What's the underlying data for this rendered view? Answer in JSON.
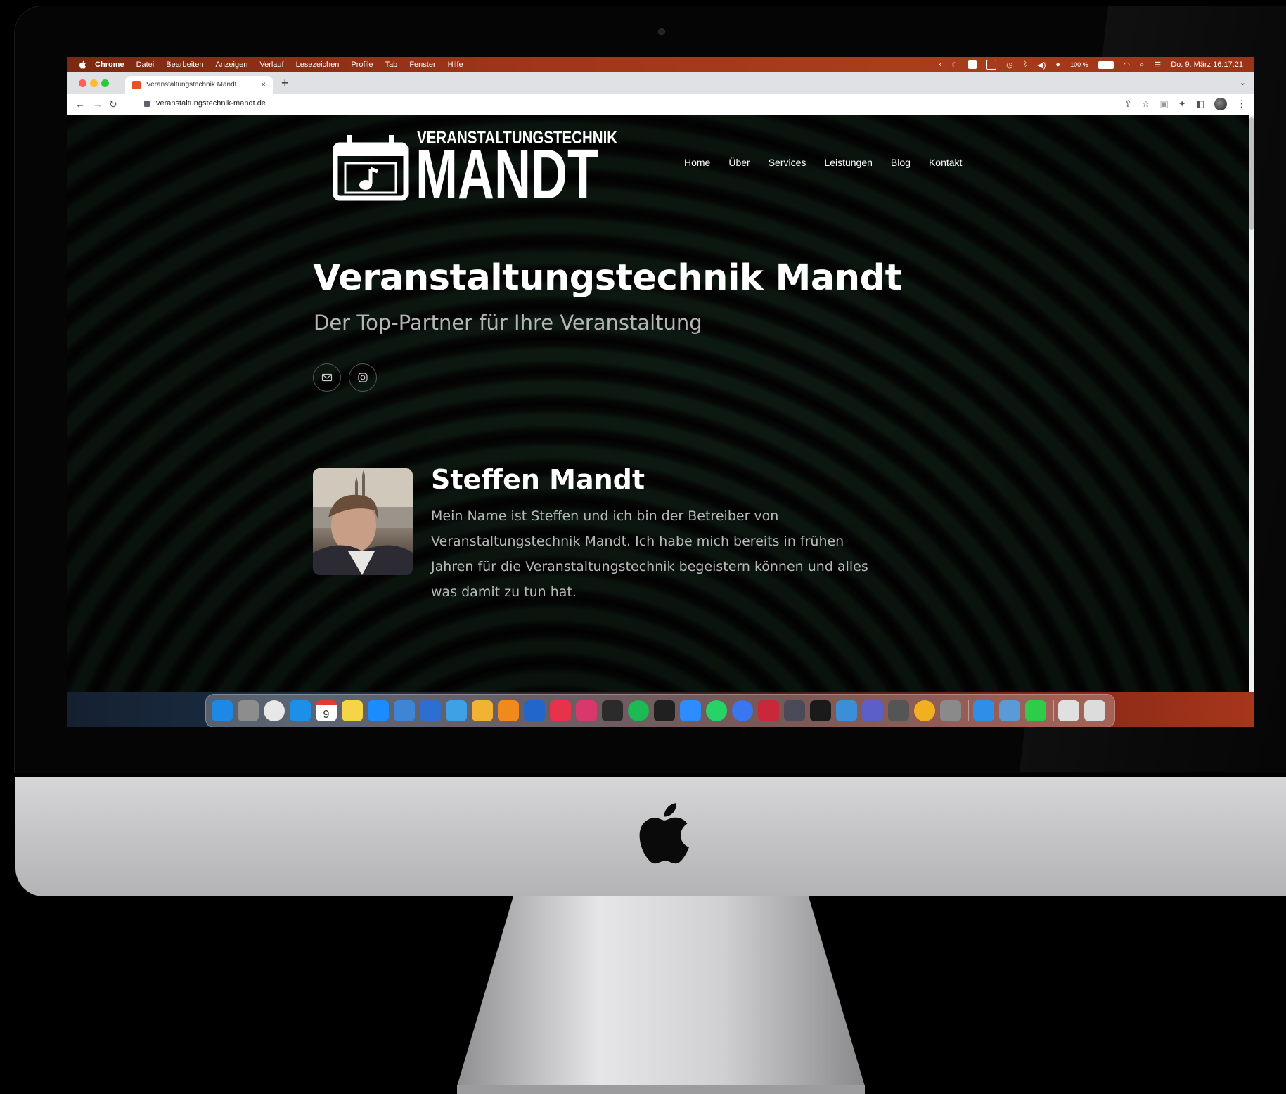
{
  "menubar": {
    "items": [
      "Chrome",
      "Datei",
      "Bearbeiten",
      "Anzeigen",
      "Verlauf",
      "Lesezeichen",
      "Profile",
      "Tab",
      "Fenster",
      "Hilfe"
    ],
    "battery": "100 %",
    "datetime": "Do. 9. März  16:17:21"
  },
  "browser": {
    "tab_title": "Veranstaltungstechnik Mandt",
    "url": "veranstaltungstechnik-mandt.de",
    "new_tab_symbol": "+"
  },
  "site": {
    "logo_small": "VERANSTALTUNGSTECHNIK",
    "logo_big": "MANDT",
    "nav": [
      "Home",
      "Über",
      "Services",
      "Leistungen",
      "Blog",
      "Kontakt"
    ],
    "hero_title": "Veranstaltungstechnik Mandt",
    "hero_subtitle": "Der Top-Partner für Ihre Veranstaltung",
    "social_icons": [
      "mail-icon",
      "instagram-icon"
    ],
    "bio": {
      "name": "Steffen Mandt",
      "text": "Mein Name ist Steffen und ich bin der Betreiber von Veranstaltungstechnik Mandt. Ich habe mich bereits in frühen Jahren für die Veranstaltungstechnik begeistern können und alles was damit zu tun hat."
    }
  },
  "dock": {
    "icons": [
      "finder-icon",
      "launchpad-icon",
      "chrome-icon",
      "mail-icon",
      "calendar-icon",
      "notes-icon",
      "app-store-icon",
      "xcode-icon",
      "simulator-icon",
      "ssh-icon",
      "cyberduck-icon",
      "sublime-icon",
      "1password-icon",
      "creative-cloud-icon",
      "intellij-icon",
      "final-cut-icon",
      "spotify-icon",
      "terminal-icon",
      "zoom-icon",
      "whatsapp-icon",
      "signal-icon",
      "db-icon",
      "preview-icon",
      "activity-icon",
      "screen-sharing-icon",
      "teams-icon",
      "disk-icon",
      "amphetamine-icon",
      "settings-icon",
      "migration-icon",
      "remote-desktop-icon",
      "facetime-icon",
      "file-icon",
      "trash-icon"
    ],
    "colors": [
      "#1e88e5",
      "#8d8d8d",
      "#e8e8e8",
      "#1e8fe8",
      "#ffffff",
      "#f5d547",
      "#1a8cff",
      "#3f85d6",
      "#2d6ed1",
      "#3ea1e6",
      "#f2b233",
      "#f08a1d",
      "#2266cc",
      "#e8324a",
      "#d8386c",
      "#2b2b2b",
      "#1db954",
      "#202020",
      "#2d8cff",
      "#25d366",
      "#3a76f0",
      "#c8283a",
      "#4a4a58",
      "#1a1a1a",
      "#3a8fd8",
      "#5b5fc7",
      "#555555",
      "#f0b020",
      "#8a8a8a",
      "#2f8fe8",
      "#5a9ad6",
      "#2ecc48",
      "#e0e0e0",
      "#dcdcdc"
    ],
    "calendar_day": "9"
  }
}
